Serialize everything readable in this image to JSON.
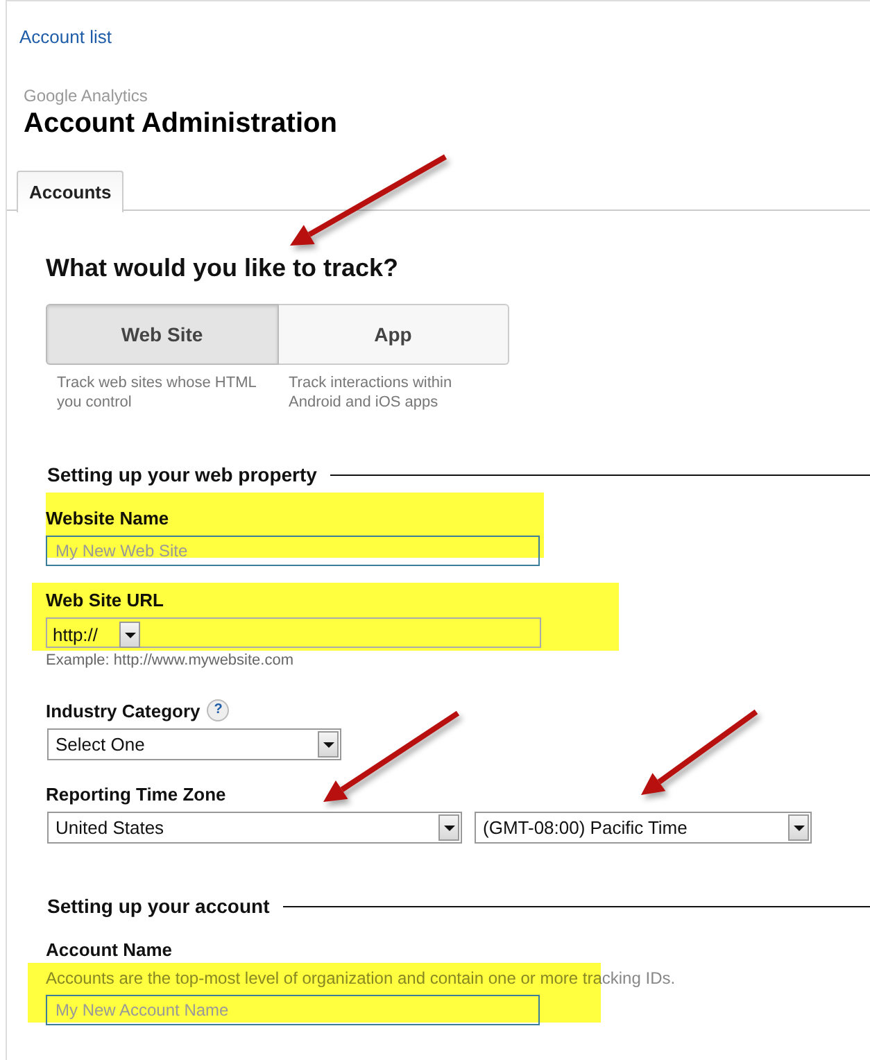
{
  "breadcrumb": "Account list",
  "app_name": "Google Analytics",
  "page_title": "Account Administration",
  "tabs": [
    {
      "label": "Accounts",
      "selected": true
    }
  ],
  "track": {
    "heading": "What would you like to track?",
    "arrow": true,
    "options": [
      {
        "label": "Web Site",
        "description": "Track web sites whose HTML you control",
        "selected": true
      },
      {
        "label": "App",
        "description": "Track interactions within Android and iOS apps",
        "selected": false
      }
    ]
  },
  "sections": [
    {
      "title": "Setting up your web property",
      "fields": [
        {
          "kind": "text",
          "label": "Website Name",
          "placeholder": "My New Web Site",
          "highlighted": true
        },
        {
          "kind": "url",
          "label": "Web Site URL",
          "protocol": "http://",
          "hint": "Example: http://www.mywebsite.com",
          "highlighted": true
        },
        {
          "kind": "select",
          "label": "Industry Category",
          "help": "?",
          "selects": [
            {
              "value": "Select One"
            }
          ]
        },
        {
          "kind": "select",
          "label": "Reporting Time Zone",
          "selects": [
            {
              "value": "United States",
              "arrow": true
            },
            {
              "value": "(GMT-08:00) Pacific Time",
              "arrow": true
            }
          ]
        }
      ]
    },
    {
      "title": "Setting up your account",
      "fields": [
        {
          "kind": "text",
          "label": "Account Name",
          "description": "Accounts are the top-most level of organization and contain one or more tracking IDs.",
          "placeholder": "My New Account Name",
          "highlighted": true
        }
      ]
    }
  ]
}
